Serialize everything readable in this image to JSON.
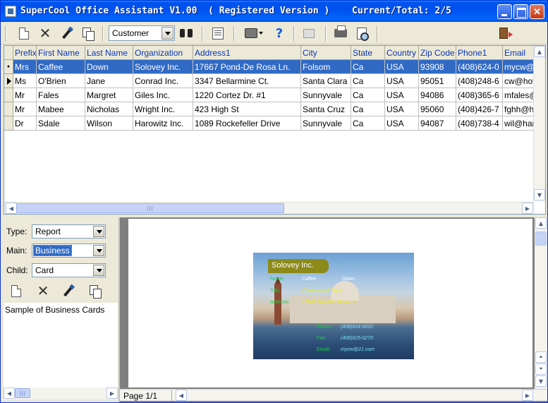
{
  "window": {
    "title": "SuperCool Office Assistant V1.00  ( Registered Version )",
    "status": "Current/Total: 2/5"
  },
  "toolbar": {
    "record_type": "Customer"
  },
  "grid": {
    "columns": [
      "Prefix",
      "First Name",
      "Last Name",
      "Organization",
      "Address1",
      "City",
      "State",
      "Country",
      "Zip Code",
      "Phone1",
      "Email"
    ],
    "rows": [
      [
        "Mrs",
        "Caffee",
        "Down",
        "Solovey Inc.",
        "17667 Pond-De Rosa Ln.",
        "Folsom",
        "Ca",
        "USA",
        "93908",
        "(408)624-0",
        "mycw@"
      ],
      [
        "Ms",
        "O'Brien",
        "Jane",
        "Conrad Inc.",
        "3347 Bellarmine Ct.",
        "Santa Clara",
        "Ca",
        "USA",
        "95051",
        "(408)248-6",
        "cw@hot"
      ],
      [
        "Mr",
        "Fales",
        "Margret",
        "Giles Inc.",
        "1220 Cortez Dr. #1",
        "Sunnyvale",
        "Ca",
        "USA",
        "94086",
        "(408)365-6",
        "mfales@"
      ],
      [
        "Mr",
        "Mabee",
        "Nicholas",
        "Wright Inc.",
        "423 High St",
        "Santa Cruz",
        "Ca",
        "USA",
        "95060",
        "(408)426-7",
        "fghh@h"
      ],
      [
        "Dr",
        "Sdale",
        "Wilson",
        "Harowitz Inc.",
        "1089 Rockefeller Drive",
        "Sunnyvale",
        "Ca",
        "USA",
        "94087",
        "(408)738-4",
        "wil@har"
      ]
    ]
  },
  "leftpanel": {
    "type_label": "Type:",
    "type_value": "Report",
    "main_label": "Main:",
    "main_value": "Business",
    "child_label": "Child:",
    "child_value": "Card",
    "description": "Sample of Business Cards"
  },
  "preview": {
    "page_info": "Page 1/1",
    "card": {
      "company": "Solovey Inc.",
      "name_label": "Name:",
      "first_name": "Caffee",
      "last_name": "Down",
      "title_label": "Title:",
      "title": "Chairman of T.H.K",
      "address_label": "Address:",
      "address": "17667 Pond-De Rosa Ln.",
      "phone_label": "Phone:",
      "phone": "(408)624-0010",
      "fax_label": "Fax:",
      "fax": "(408)625-0270",
      "email_label": "Email:",
      "email": "mycw@21.com"
    }
  }
}
